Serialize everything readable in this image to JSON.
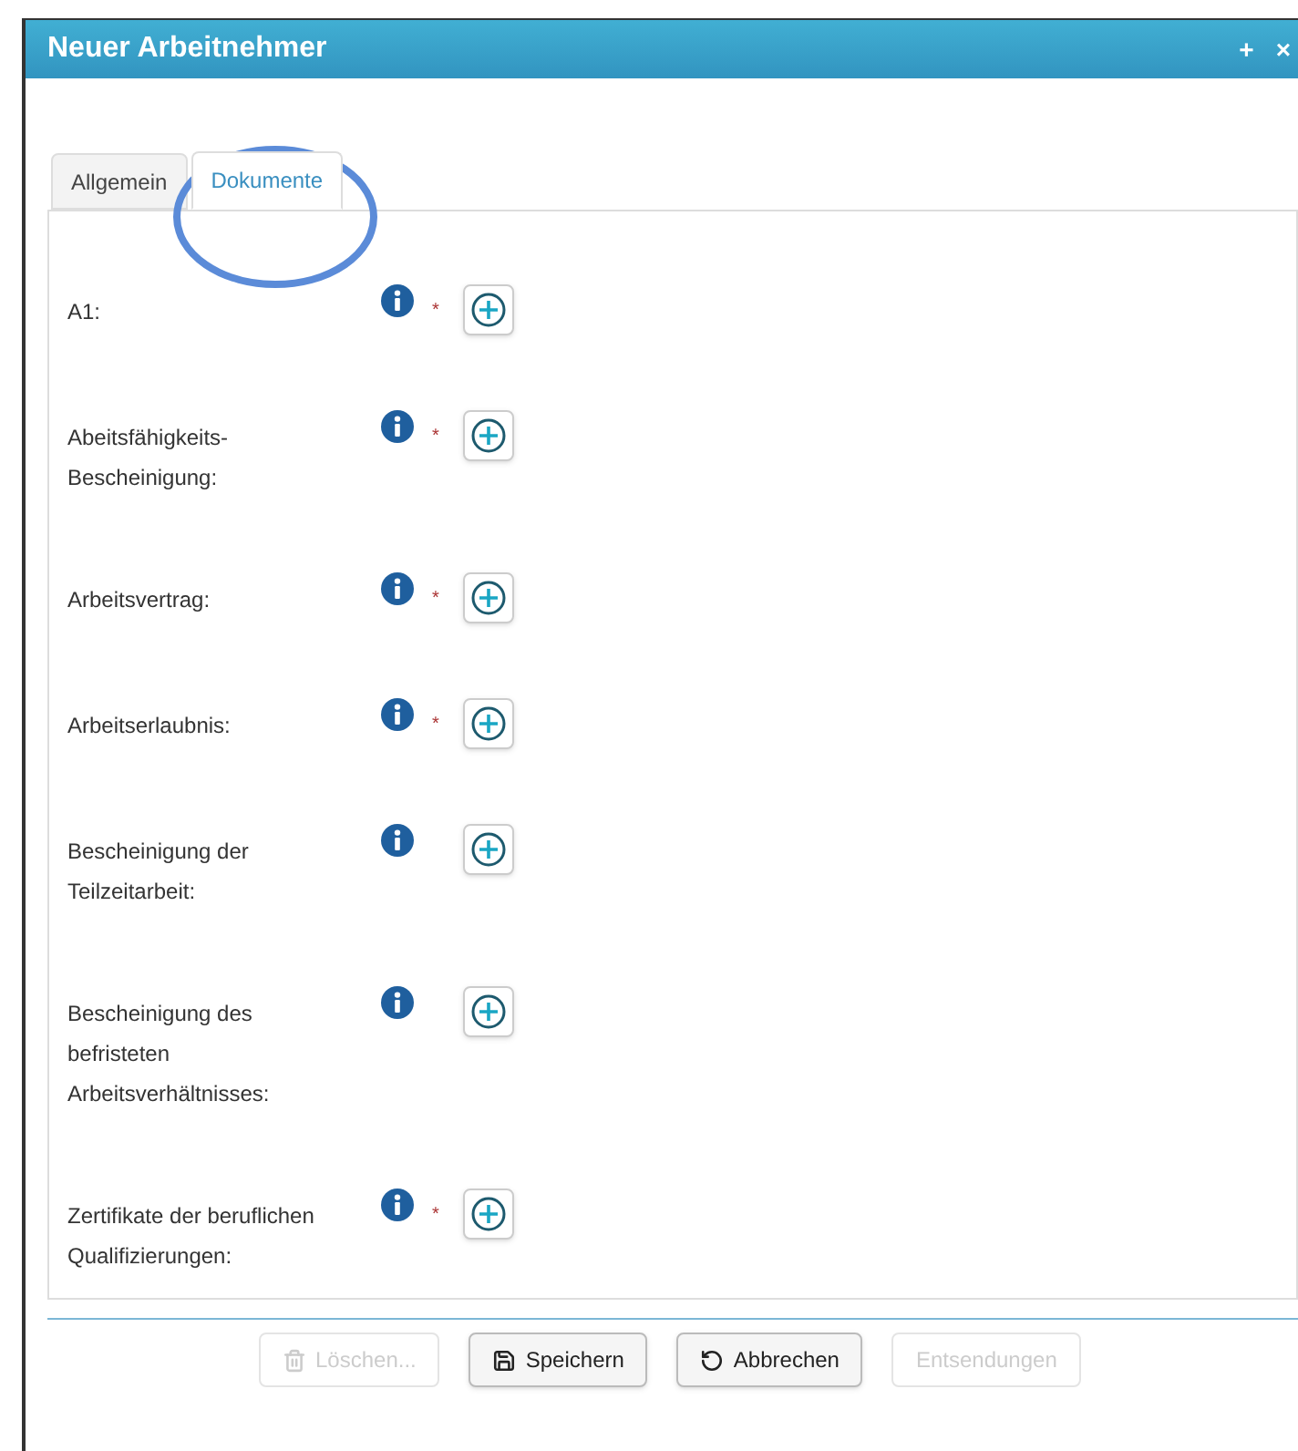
{
  "window": {
    "title": "Neuer Arbeitnehmer",
    "controls": [
      "+",
      "×"
    ]
  },
  "tabs": [
    {
      "label": "Allgemein",
      "selected": false
    },
    {
      "label": "Dokumente",
      "selected": true
    }
  ],
  "documents": [
    {
      "label": "A1:",
      "marker": "*"
    },
    {
      "label": "Abeitsfähigkeits-Bescheinigung:",
      "marker": "*"
    },
    {
      "label": "Arbeitsvertrag:",
      "marker": "*"
    },
    {
      "label": "Arbeitserlaubnis:",
      "marker": "*"
    },
    {
      "label": "Bescheinigung der Teilzeitarbeit:"
    },
    {
      "label": "Bescheinigung des befristeten Arbeitsverhältnisses:"
    },
    {
      "label": "Zertifikate der beruflichen Qualifizierungen:",
      "marker": "*"
    }
  ],
  "buttons": [
    {
      "label": "Löschen...",
      "kind": "delete",
      "disabled": true
    },
    {
      "label": "Speichern",
      "kind": "save",
      "disabled": false
    },
    {
      "label": "Abbrechen",
      "kind": "cancel",
      "disabled": false
    },
    {
      "label": "Entsendungen",
      "kind": "plain",
      "disabled": true
    }
  ],
  "annotation": {
    "kind": "ellipse",
    "color": "#5b8bd8"
  }
}
